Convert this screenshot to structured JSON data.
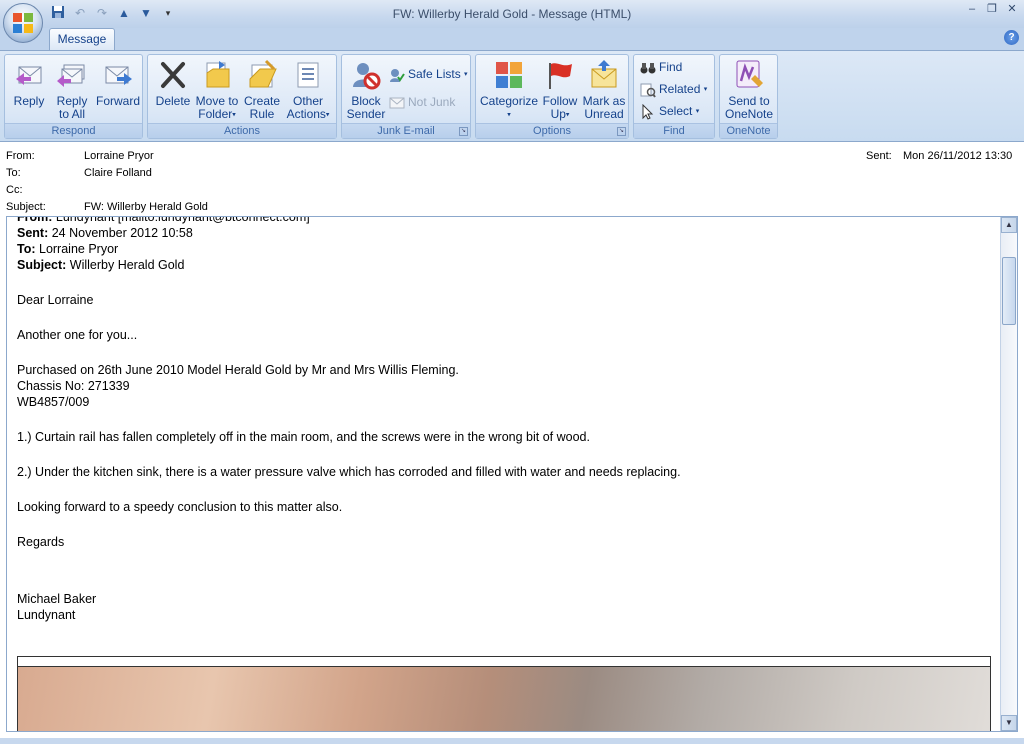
{
  "window": {
    "title": "FW: Willerby Herald Gold - Message (HTML)",
    "controls": {
      "minimize": "–",
      "restore": "❐",
      "close": "✕"
    }
  },
  "qat": {
    "save_icon": "save-icon",
    "undo_icon": "undo-icon",
    "redo_icon": "redo-icon",
    "up_icon": "previous-item-icon",
    "down_icon": "next-item-icon",
    "customize": "▾"
  },
  "tabs": {
    "message": "Message",
    "help": "?"
  },
  "ribbon": {
    "respond": {
      "label": "Respond",
      "reply": "Reply",
      "reply_all_1": "Reply",
      "reply_all_2": "to All",
      "forward": "Forward"
    },
    "actions": {
      "label": "Actions",
      "delete": "Delete",
      "move_1": "Move to",
      "move_2": "Folder",
      "create_1": "Create",
      "create_2": "Rule",
      "other_1": "Other",
      "other_2": "Actions"
    },
    "junk": {
      "label": "Junk E-mail",
      "block_1": "Block",
      "block_2": "Sender",
      "safe_lists": "Safe Lists",
      "not_junk": "Not Junk"
    },
    "options": {
      "label": "Options",
      "categorize": "Categorize",
      "follow_1": "Follow",
      "follow_2": "Up",
      "mark_1": "Mark as",
      "mark_2": "Unread"
    },
    "find": {
      "label": "Find",
      "find": "Find",
      "related": "Related",
      "select": "Select"
    },
    "onenote": {
      "label": "OneNote",
      "send_1": "Send to",
      "send_2": "OneNote"
    }
  },
  "header": {
    "from_label": "From:",
    "from": "Lorraine Pryor",
    "to_label": "To:",
    "to": "Claire Folland",
    "cc_label": "Cc:",
    "cc": "",
    "subject_label": "Subject:",
    "subject": "FW: Willerby Herald Gold",
    "sent_label": "Sent:",
    "sent": "Mon 26/11/2012 13:30"
  },
  "body": {
    "partial_line": "From: Lundynant [mailto:lundynant@btconnect.com]",
    "sent_label": "Sent:",
    "sent": " 24 November 2012 10:58",
    "to_label": "To:",
    "to": " Lorraine Pryor",
    "subject_label": "Subject:",
    "subject": " Willerby Herald Gold",
    "greeting": "Dear Lorraine",
    "line1": "Another one for you...",
    "line2": "Purchased on 26th June 2010 Model Herald Gold by Mr and Mrs Willis Fleming.",
    "line3": "Chassis No: 271339",
    "line4": "WB4857/009",
    "item1": "1.)  Curtain rail has fallen completely off in the main room, and the screws were in the wrong bit of wood.",
    "item2": "2.) Under the kitchen sink, there is a water pressure valve which has corroded and filled with water and needs replacing.",
    "closing_line": "Looking forward to a speedy conclusion to this matter also.",
    "regards": "Regards",
    "sig_name": "Michael Baker",
    "sig_company": "Lundynant"
  },
  "colors": {
    "accent": "#15428b",
    "ribbon_bg": "#dce8f6",
    "group_label": "#3e6aaa"
  }
}
